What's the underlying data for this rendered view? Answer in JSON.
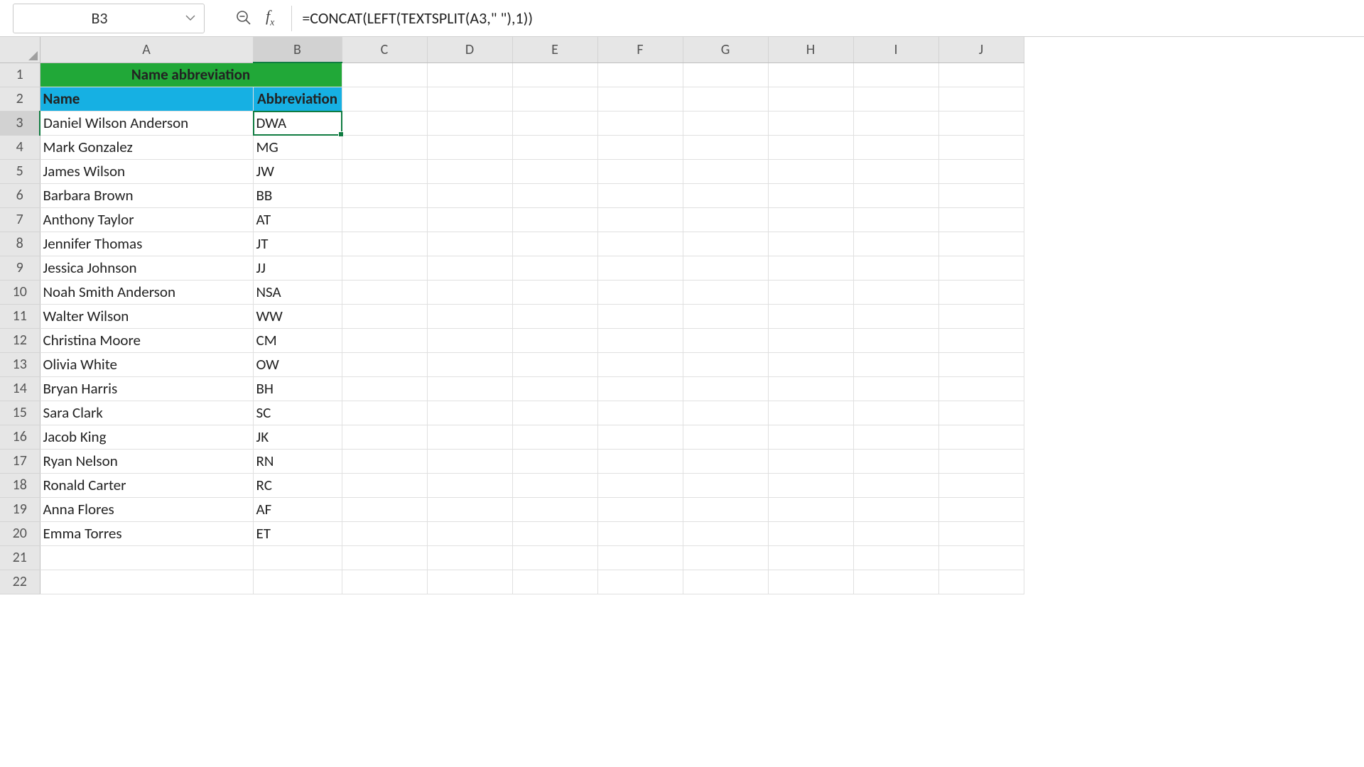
{
  "nameBox": {
    "value": "B3"
  },
  "formulaBar": {
    "formula": "=CONCAT(LEFT(TEXTSPLIT(A3,\" \"),1))"
  },
  "columns": [
    "A",
    "B",
    "C",
    "D",
    "E",
    "F",
    "G",
    "H",
    "I",
    "J"
  ],
  "rowCount": 22,
  "selectedCell": {
    "col": "B",
    "row": 3
  },
  "title": {
    "text": "Name abbreviation"
  },
  "headers": {
    "name": "Name",
    "abbrev": "Abbreviation"
  },
  "data": [
    {
      "name": "Daniel Wilson Anderson",
      "abbrev": "DWA"
    },
    {
      "name": "Mark Gonzalez",
      "abbrev": "MG"
    },
    {
      "name": "James Wilson",
      "abbrev": "JW"
    },
    {
      "name": "Barbara Brown",
      "abbrev": "BB"
    },
    {
      "name": "Anthony Taylor",
      "abbrev": "AT"
    },
    {
      "name": "Jennifer Thomas",
      "abbrev": "JT"
    },
    {
      "name": "Jessica Johnson",
      "abbrev": "JJ"
    },
    {
      "name": "Noah Smith Anderson",
      "abbrev": "NSA"
    },
    {
      "name": "Walter Wilson",
      "abbrev": "WW"
    },
    {
      "name": "Christina Moore",
      "abbrev": "CM"
    },
    {
      "name": "Olivia White",
      "abbrev": "OW"
    },
    {
      "name": "Bryan Harris",
      "abbrev": "BH"
    },
    {
      "name": "Sara Clark",
      "abbrev": "SC"
    },
    {
      "name": "Jacob King",
      "abbrev": "JK"
    },
    {
      "name": "Ryan Nelson",
      "abbrev": "RN"
    },
    {
      "name": "Ronald Carter",
      "abbrev": "RC"
    },
    {
      "name": "Anna Flores",
      "abbrev": "AF"
    },
    {
      "name": "Emma Torres",
      "abbrev": "ET"
    }
  ]
}
